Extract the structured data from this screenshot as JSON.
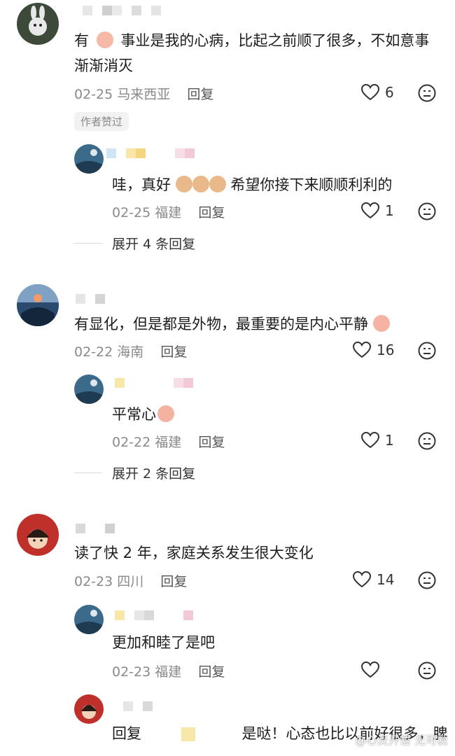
{
  "comments": [
    {
      "text_a": "有",
      "text_b": "事业是我的心病，比起之前顺了很多，不如意事渐渐消灭",
      "date": "02-25",
      "location": "马来西亚",
      "reply_label": "回复",
      "likes": "6",
      "badge": "作者赞过",
      "reply": {
        "text_a": "哇，真好",
        "text_b": "希望你接下来顺顺利利的",
        "date": "02-25",
        "location": "福建",
        "reply_label": "回复",
        "likes": "1"
      },
      "expand_label": "展开 4 条回复"
    },
    {
      "text": "有显化，但是都是外物，最重要的是内心平静",
      "date": "02-22",
      "location": "海南",
      "reply_label": "回复",
      "likes": "16",
      "reply": {
        "text": "平常心",
        "date": "02-22",
        "location": "福建",
        "reply_label": "回复",
        "likes": "1"
      },
      "expand_label": "展开 2 条回复"
    },
    {
      "text": "读了快 2 年，家庭关系发生很大变化",
      "date": "02-23",
      "location": "四川",
      "reply_label": "回复",
      "likes": "14",
      "reply": {
        "text": "更加和睦了是吧",
        "date": "02-23",
        "location": "福建",
        "reply_label": "回复",
        "likes": ""
      },
      "reply2": {
        "prefix": "回复",
        "text": "是哒！心态也比以前好很多，脾"
      }
    }
  ],
  "watermark": "@心灵开悟 无可救",
  "icons": {
    "like": "heart-outline-icon",
    "dislike": "neutral-face-icon"
  },
  "colors": {
    "text": "#1c1c1c",
    "meta": "#8a8a8a",
    "icon": "#333333"
  }
}
